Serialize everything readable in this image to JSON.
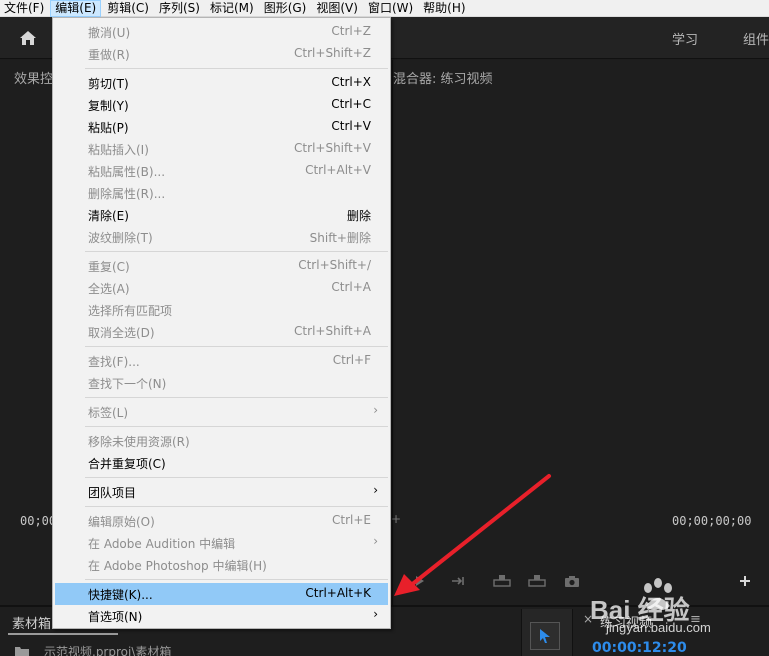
{
  "menubar": {
    "items": [
      "文件(F)",
      "编辑(E)",
      "剪辑(C)",
      "序列(S)",
      "标记(M)",
      "图形(G)",
      "视图(V)",
      "窗口(W)",
      "帮助(H)"
    ]
  },
  "header": {
    "workspaces": [
      "学习",
      "组件"
    ]
  },
  "panels": {
    "left_title": "效果控",
    "right_title": "混合器: 练习视频",
    "left_timecode": "00;00",
    "right_timecode": "00;00;00;00"
  },
  "edit_menu": {
    "items": [
      {
        "label": "撤消(U)",
        "shortcut": "Ctrl+Z",
        "enabled": false
      },
      {
        "label": "重做(R)",
        "shortcut": "Ctrl+Shift+Z",
        "enabled": false
      },
      {
        "label": "剪切(T)",
        "shortcut": "Ctrl+X",
        "enabled": true
      },
      {
        "label": "复制(Y)",
        "shortcut": "Ctrl+C",
        "enabled": true
      },
      {
        "label": "粘贴(P)",
        "shortcut": "Ctrl+V",
        "enabled": true
      },
      {
        "label": "粘贴插入(I)",
        "shortcut": "Ctrl+Shift+V",
        "enabled": false
      },
      {
        "label": "粘贴属性(B)...",
        "shortcut": "Ctrl+Alt+V",
        "enabled": false
      },
      {
        "label": "删除属性(R)...",
        "shortcut": "",
        "enabled": false
      },
      {
        "label": "清除(E)",
        "shortcut": "删除",
        "enabled": true
      },
      {
        "label": "波纹删除(T)",
        "shortcut": "Shift+删除",
        "enabled": false
      },
      {
        "label": "重复(C)",
        "shortcut": "Ctrl+Shift+/",
        "enabled": false
      },
      {
        "label": "全选(A)",
        "shortcut": "Ctrl+A",
        "enabled": false
      },
      {
        "label": "选择所有匹配项",
        "shortcut": "",
        "enabled": false
      },
      {
        "label": "取消全选(D)",
        "shortcut": "Ctrl+Shift+A",
        "enabled": false
      },
      {
        "label": "查找(F)...",
        "shortcut": "Ctrl+F",
        "enabled": false
      },
      {
        "label": "查找下一个(N)",
        "shortcut": "",
        "enabled": false
      },
      {
        "label": "标签(L)",
        "shortcut": "",
        "enabled": false,
        "submenu": true
      },
      {
        "label": "移除未使用资源(R)",
        "shortcut": "",
        "enabled": false
      },
      {
        "label": "合并重复项(C)",
        "shortcut": "",
        "enabled": true
      },
      {
        "label": "团队项目",
        "shortcut": "",
        "enabled": true,
        "submenu": true
      },
      {
        "label": "编辑原始(O)",
        "shortcut": "Ctrl+E",
        "enabled": false
      },
      {
        "label": "在 Adobe Audition 中编辑",
        "shortcut": "",
        "enabled": false,
        "submenu": true
      },
      {
        "label": "在 Adobe Photoshop 中编辑(H)",
        "shortcut": "",
        "enabled": false
      },
      {
        "label": "快捷键(K)...",
        "shortcut": "Ctrl+Alt+K",
        "enabled": true,
        "highlighted": true
      },
      {
        "label": "首选项(N)",
        "shortcut": "",
        "enabled": true,
        "submenu": true
      }
    ]
  },
  "bottom": {
    "tab_label": "素材箱",
    "breadcrumb": "示范视频.prproj\\素材箱",
    "sequence_name": "练习视频",
    "sequence_close": "×",
    "sequence_menu": "≡",
    "sequence_timecode": "00:00:12:20"
  },
  "watermark": {
    "logo_text": "Bai 经验",
    "url": "jingyan.baidu.com"
  },
  "colors": {
    "menu_highlight": "#91c9f7",
    "active_menubar": "#cce8ff",
    "timecode_blue": "#2d8ceb",
    "arrow_red": "#e8202a",
    "panel_bg": "#1e1e1e"
  }
}
